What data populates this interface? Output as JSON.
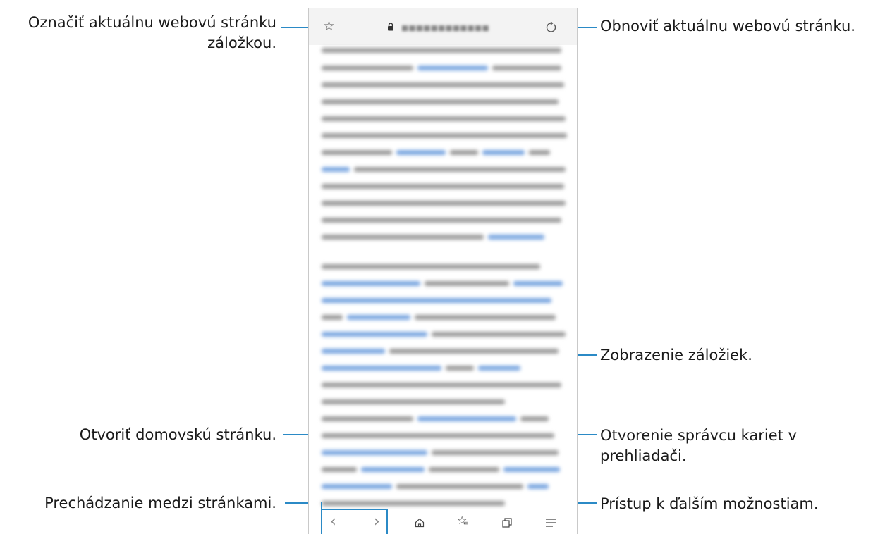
{
  "callouts": {
    "bookmark_page": "Označiť aktuálnu webovú stránku záložkou.",
    "refresh": "Obnoviť aktuálnu webovú stránku.",
    "view_bookmarks": "Zobrazenie záložiek.",
    "home": "Otvoriť domovskú stránku.",
    "tabs_manager_line1": "Otvorenie správcu kariet v",
    "tabs_manager_line2": "prehliadači.",
    "navigate": "Prechádzanie medzi stránkami.",
    "more_options": "Prístup k ďalším možnostiam."
  },
  "browser": {
    "icons": {
      "bookmark": "star-outline-icon",
      "lock": "lock-icon",
      "refresh": "refresh-icon",
      "back": "chevron-left-icon",
      "forward": "chevron-right-icon",
      "home": "home-icon",
      "bookmarks_list": "star-list-icon",
      "tabs": "tabs-icon",
      "menu": "menu-icon"
    }
  },
  "colors": {
    "accent_line": "#2b8ac6",
    "blurred_text": "#9a9a9a",
    "blurred_link": "#7aa6e0"
  }
}
